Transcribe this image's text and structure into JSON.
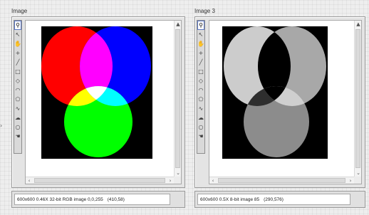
{
  "panels": {
    "left": {
      "title": "Image",
      "status_info": "600x600 0.46X 32-bit RGB image 0,0,255",
      "status_coords": "(410,58)"
    },
    "right": {
      "title": "Image 3",
      "status_info": "600x600 0.5X 8-bit image 85",
      "status_coords": "(290,576)"
    }
  },
  "tools": [
    {
      "name": "zoom-tool",
      "glyph": "⚲",
      "selected": true
    },
    {
      "name": "pointer-tool",
      "glyph": "↖",
      "selected": false
    },
    {
      "name": "pan-tool",
      "glyph": "✋",
      "selected": false
    },
    {
      "name": "point-tool",
      "glyph": "+",
      "selected": false
    },
    {
      "name": "line-tool",
      "glyph": "╱",
      "selected": false
    },
    {
      "name": "rectangle-tool",
      "glyph": "□",
      "selected": false
    },
    {
      "name": "rotated-rectangle-tool",
      "glyph": "◇",
      "selected": false
    },
    {
      "name": "annulus-tool",
      "glyph": "◠",
      "selected": false
    },
    {
      "name": "polygon-tool",
      "glyph": "⬠",
      "selected": false
    },
    {
      "name": "freehand-line-tool",
      "glyph": "∿",
      "selected": false
    },
    {
      "name": "freehand-region-tool",
      "glyph": "☁",
      "selected": false
    },
    {
      "name": "oval-tool",
      "glyph": "○",
      "selected": false
    },
    {
      "name": "hand-tool",
      "glyph": "☚",
      "selected": false
    }
  ],
  "scroll_glyphs": {
    "up": "▲",
    "down": "⌄",
    "left": "‹",
    "right": "›"
  },
  "colors": {
    "red": "#ff0000",
    "green": "#00ff00",
    "blue": "#0000ff",
    "magenta": "#ff00ff",
    "yellow": "#ffff00",
    "cyan": "#00ffff",
    "white": "#ffffff",
    "gray_red": "#4d4d4d",
    "gray_green": "#8c8c8c",
    "gray_blue": "#1a1a1a",
    "gray_magenta": "#000000",
    "gray_yellow": "#2e2e2e",
    "gray_cyan": "#cfcfcf",
    "gray_white": "#000000",
    "gray_top_left": "#cccccc",
    "gray_top_right": "#a8a8a8",
    "gray_bottom": "#8c8c8c"
  }
}
